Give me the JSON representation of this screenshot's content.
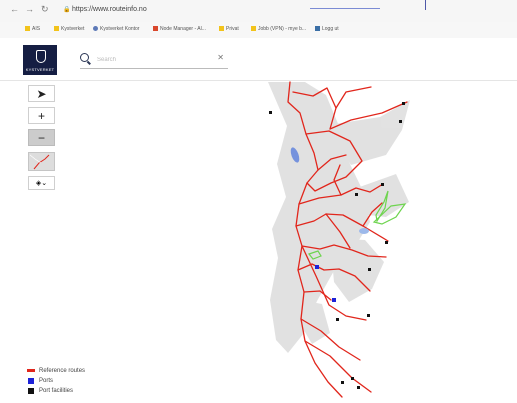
{
  "browser": {
    "url": "https://www.routeinfo.no",
    "bookmarks": [
      {
        "label": "AIS",
        "color": "#f2c31b"
      },
      {
        "label": "Kystverket",
        "color": "#f2c31b"
      },
      {
        "label": "Kystverket Kontor",
        "color": "#5d79b7"
      },
      {
        "label": "Node Manager - Al...",
        "color": "#d9472c"
      },
      {
        "label": "Privat",
        "color": "#f2c31b"
      },
      {
        "label": "Jobb (VPN) - mye b...",
        "color": "#f2c31b"
      },
      {
        "label": "Logg ut",
        "color": "#3b6fa6"
      }
    ]
  },
  "header": {
    "logo_text": "KYSTVERKET",
    "search": {
      "placeholder": "Search"
    }
  },
  "controls": {
    "zoom_in": "+",
    "zoom_out": "−"
  },
  "legend": [
    {
      "label": "Reference routes",
      "color": "#e1261c"
    },
    {
      "label": "Ports",
      "color": "#1d22d9"
    },
    {
      "label": "Port facilities",
      "color": "#111111"
    }
  ],
  "colors": {
    "logo_bg": "#151e43",
    "route_red": "#e1261c",
    "map_gray": "#d8d8d8"
  }
}
